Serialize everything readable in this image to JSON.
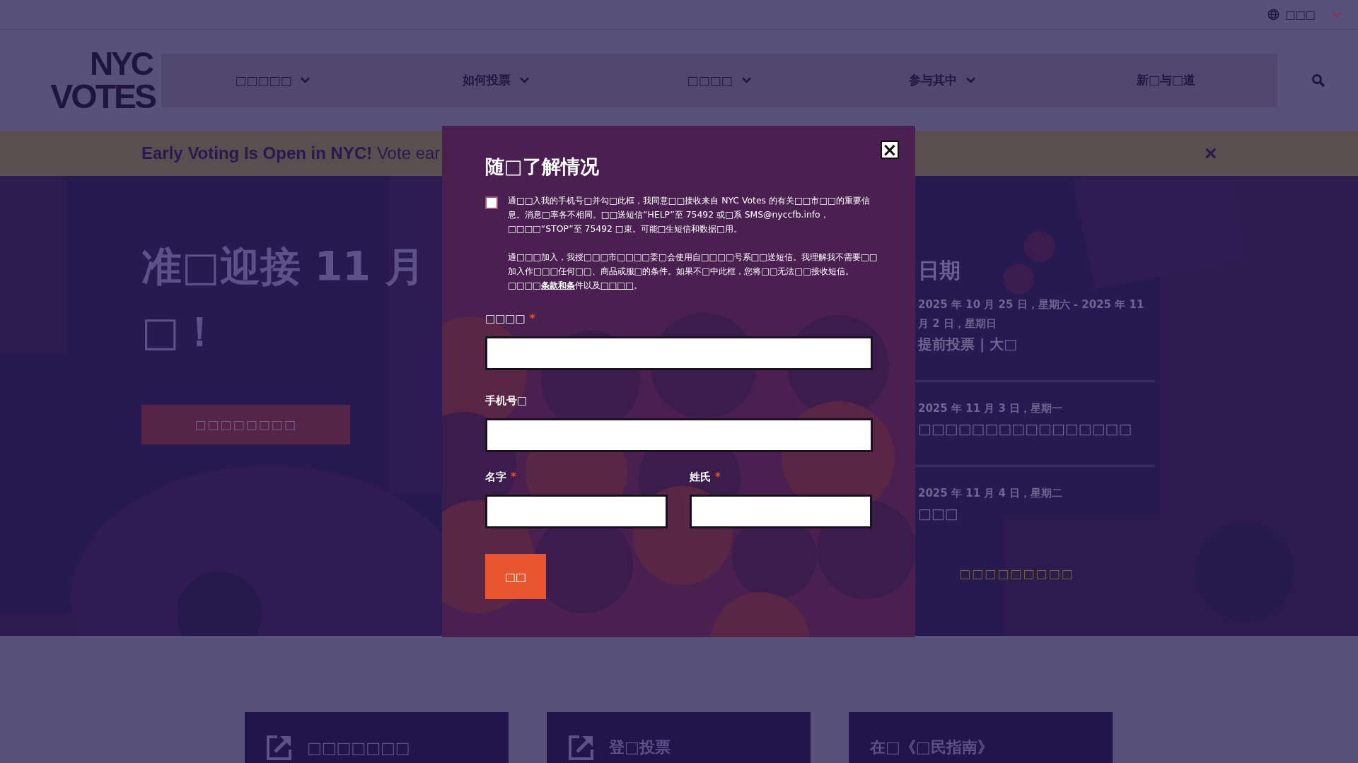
{
  "language_selector": {
    "label": "□□□"
  },
  "logo": {
    "line_1": "NYC",
    "line_2": "VOTES"
  },
  "nav": {
    "items": [
      {
        "label": "□□□□□",
        "has_menu": true
      },
      {
        "label": "如何投票",
        "has_menu": true
      },
      {
        "label": "□□□□",
        "has_menu": true
      },
      {
        "label": "参与其中",
        "has_menu": true
      },
      {
        "label": "新□与□道",
        "has_menu": false
      }
    ]
  },
  "banner": {
    "text": "**Early Voting Is Open in NYC!** Vote ear",
    "close": "×"
  },
  "hero": {
    "heading_lines": [
      "准□迎接 11 月",
      "□！"
    ],
    "button": "□□□□□□□□"
  },
  "dates": {
    "heading": "日期",
    "items": [
      {
        "date": "2025 年 10 月 25 日，星期六 - 2025 年 11 月 2 日，星期日",
        "title": "提前投票 | 大□"
      },
      {
        "date": "2025 年 11 月 3 日，星期一",
        "title": "□□□□□□□□□□□□□□□□"
      },
      {
        "date": "2025 年 11 月 4 日，星期二",
        "title": "□□□"
      }
    ],
    "link": "□□□□□□□□□"
  },
  "modal": {
    "close": "×",
    "title": "随□了解情况",
    "consent": {
      "checked": false,
      "paragraph_1": "通□□入我的手机号□并勾□此框，我同意□□接收来自 NYC Votes 的有关□□市□□的重要信息。消息□率各不相同。□□送短信“HELP”至 75492 或□系 SMS@nyccfb.info，□□□□“STOP”至 75492 □束。可能□生短信和数据□用。",
      "paragraph_2": {
        "before": "通□□□加入，我授□□□市□□□□委□会使用自□□□□号系□□送短信。我理解我不需要□□加入作□□□任何□□、商品或服□的条件。如果不□中此框，您将□□无法□□接收短信。□□□□",
        "terms_link": "条款和条",
        "middle": "件以及",
        "privacy_link": "□□□□",
        "end": "。"
      }
    },
    "fields": [
      {
        "label": "□□□□",
        "required_mark": "*"
      },
      {
        "label": "手机号□"
      },
      {
        "label": "名字",
        "required_mark": "*"
      },
      {
        "label": "姓氏",
        "required_mark": "*"
      }
    ],
    "submit": "□□"
  },
  "cards": [
    {
      "label": "□□□□□□□",
      "external": true
    },
    {
      "label": "登□投票",
      "external": true
    },
    {
      "label": "在□《□民指南》",
      "external": false
    }
  ]
}
